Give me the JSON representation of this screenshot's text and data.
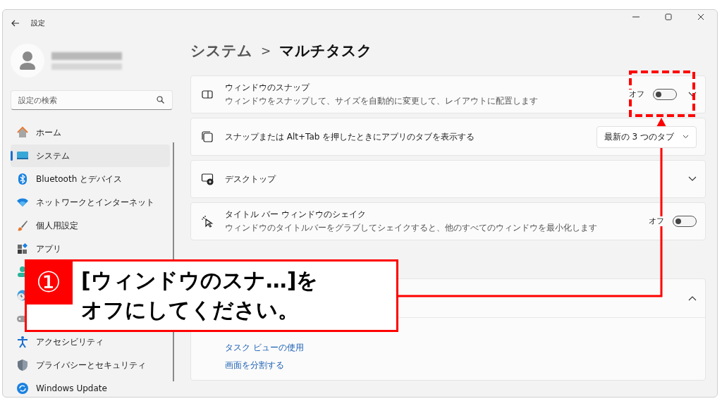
{
  "window": {
    "title": "設定"
  },
  "search": {
    "placeholder": "設定の検索"
  },
  "nav": [
    {
      "kind": "home",
      "label": "ホーム",
      "selected": false
    },
    {
      "kind": "system",
      "label": "システム",
      "selected": true
    },
    {
      "kind": "bluetooth",
      "label": "Bluetooth とデバイス",
      "selected": false
    },
    {
      "kind": "network",
      "label": "ネットワークとインターネット",
      "selected": false
    },
    {
      "kind": "brush",
      "label": "個人用設定",
      "selected": false
    },
    {
      "kind": "apps",
      "label": "アプリ",
      "selected": false
    },
    {
      "kind": "accounts",
      "selected": false
    },
    {
      "kind": "time",
      "selected": false
    },
    {
      "kind": "gaming",
      "selected": false
    },
    {
      "kind": "accessibility",
      "label": "アクセシビリティ",
      "selected": false
    },
    {
      "kind": "shield",
      "label": "プライバシーとセキュリティ",
      "selected": false
    },
    {
      "kind": "update",
      "label": "Windows Update",
      "selected": false
    }
  ],
  "breadcrumb": {
    "parent": "システム",
    "separator": ">",
    "current": "マルチタスク"
  },
  "settings": [
    {
      "kind": "toggle",
      "title": "ウィンドウのスナップ",
      "description": "ウィンドウをスナップして、サイズを自動的に変更して、レイアウトに配置します",
      "state_label": "オフ",
      "on": false,
      "expandable": true
    },
    {
      "kind": "dropdown",
      "title": "スナップまたは Alt+Tab を押したときにアプリのタブを表示する",
      "value": "最新の 3 つのタブ"
    },
    {
      "kind": "expander",
      "title": "デスクトップ"
    },
    {
      "kind": "toggle",
      "title": "タイトル バー ウィンドウのシェイク",
      "description": "ウィンドウのタイトルバーをグラブしてシェイクすると、他のすべてのウィンドウを最小化します",
      "state_label": "オフ",
      "on": false,
      "expandable": false
    }
  ],
  "support": {
    "expanded": true,
    "links": [
      "タスク ビューの使用",
      "画面を分割する"
    ]
  },
  "callout": {
    "number": "①",
    "lines": [
      "[ウィンドウのスナ…]を",
      "オフにしてください。"
    ]
  }
}
